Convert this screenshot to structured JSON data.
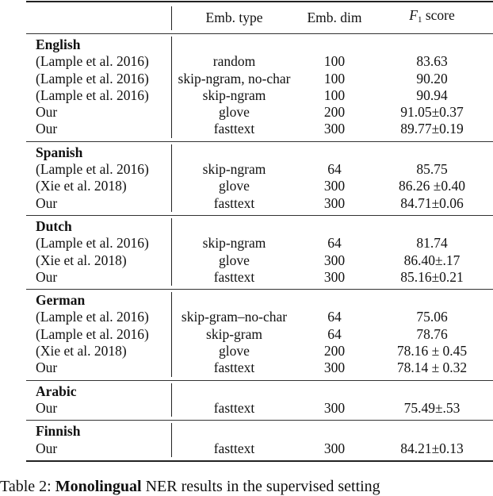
{
  "table": {
    "headers": {
      "emb_type": "Emb. type",
      "emb_dim": "Emb. dim",
      "f1_italic": "F",
      "f1_sub": "1",
      "f1_rest": " score"
    },
    "sections": [
      {
        "language": "English",
        "rows": [
          {
            "method": "(Lample et al. 2016)",
            "emb_type": "random",
            "emb_dim": "100",
            "f1": "83.63"
          },
          {
            "method": "(Lample et al. 2016)",
            "emb_type": "skip-ngram, no-char",
            "emb_dim": "100",
            "f1": "90.20"
          },
          {
            "method": "(Lample et al. 2016)",
            "emb_type": "skip-ngram",
            "emb_dim": "100",
            "f1": "90.94"
          },
          {
            "method": "Our",
            "emb_type": "glove",
            "emb_dim": "200",
            "f1": "91.05±0.37"
          },
          {
            "method": "Our",
            "emb_type": "fasttext",
            "emb_dim": "300",
            "f1": "89.77±0.19"
          }
        ]
      },
      {
        "language": "Spanish",
        "rows": [
          {
            "method": "(Lample et al. 2016)",
            "emb_type": "skip-ngram",
            "emb_dim": "64",
            "f1": "85.75"
          },
          {
            "method": "(Xie et al. 2018)",
            "emb_type": "glove",
            "emb_dim": "300",
            "f1": "86.26 ±0.40"
          },
          {
            "method": "Our",
            "emb_type": "fasttext",
            "emb_dim": "300",
            "f1": "84.71±0.06"
          }
        ]
      },
      {
        "language": "Dutch",
        "rows": [
          {
            "method": "(Lample et al. 2016)",
            "emb_type": "skip-ngram",
            "emb_dim": "64",
            "f1": "81.74"
          },
          {
            "method": "(Xie et al. 2018)",
            "emb_type": "glove",
            "emb_dim": "300",
            "f1": "86.40±.17"
          },
          {
            "method": "Our",
            "emb_type": "fasttext",
            "emb_dim": "300",
            "f1": "85.16±0.21"
          }
        ]
      },
      {
        "language": "German",
        "rows": [
          {
            "method": "(Lample et al. 2016)",
            "emb_type": "skip-gram–no-char",
            "emb_dim": "64",
            "f1": "75.06"
          },
          {
            "method": "(Lample et al. 2016)",
            "emb_type": "skip-gram",
            "emb_dim": "64",
            "f1": "78.76"
          },
          {
            "method": "(Xie et al. 2018)",
            "emb_type": "glove",
            "emb_dim": "200",
            "f1": "78.16 ± 0.45"
          },
          {
            "method": "Our",
            "emb_type": "fasttext",
            "emb_dim": "300",
            "f1": "78.14 ± 0.32"
          }
        ]
      },
      {
        "language": "Arabic",
        "rows": [
          {
            "method": "Our",
            "emb_type": "fasttext",
            "emb_dim": "300",
            "f1": "75.49±.53"
          }
        ]
      },
      {
        "language": "Finnish",
        "rows": [
          {
            "method": "Our",
            "emb_type": "fasttext",
            "emb_dim": "300",
            "f1": "84.21±0.13"
          }
        ]
      }
    ]
  },
  "caption": {
    "prefix": "Table 2: ",
    "bold": "Monolingual",
    "rest": " NER results in the supervised setting"
  }
}
